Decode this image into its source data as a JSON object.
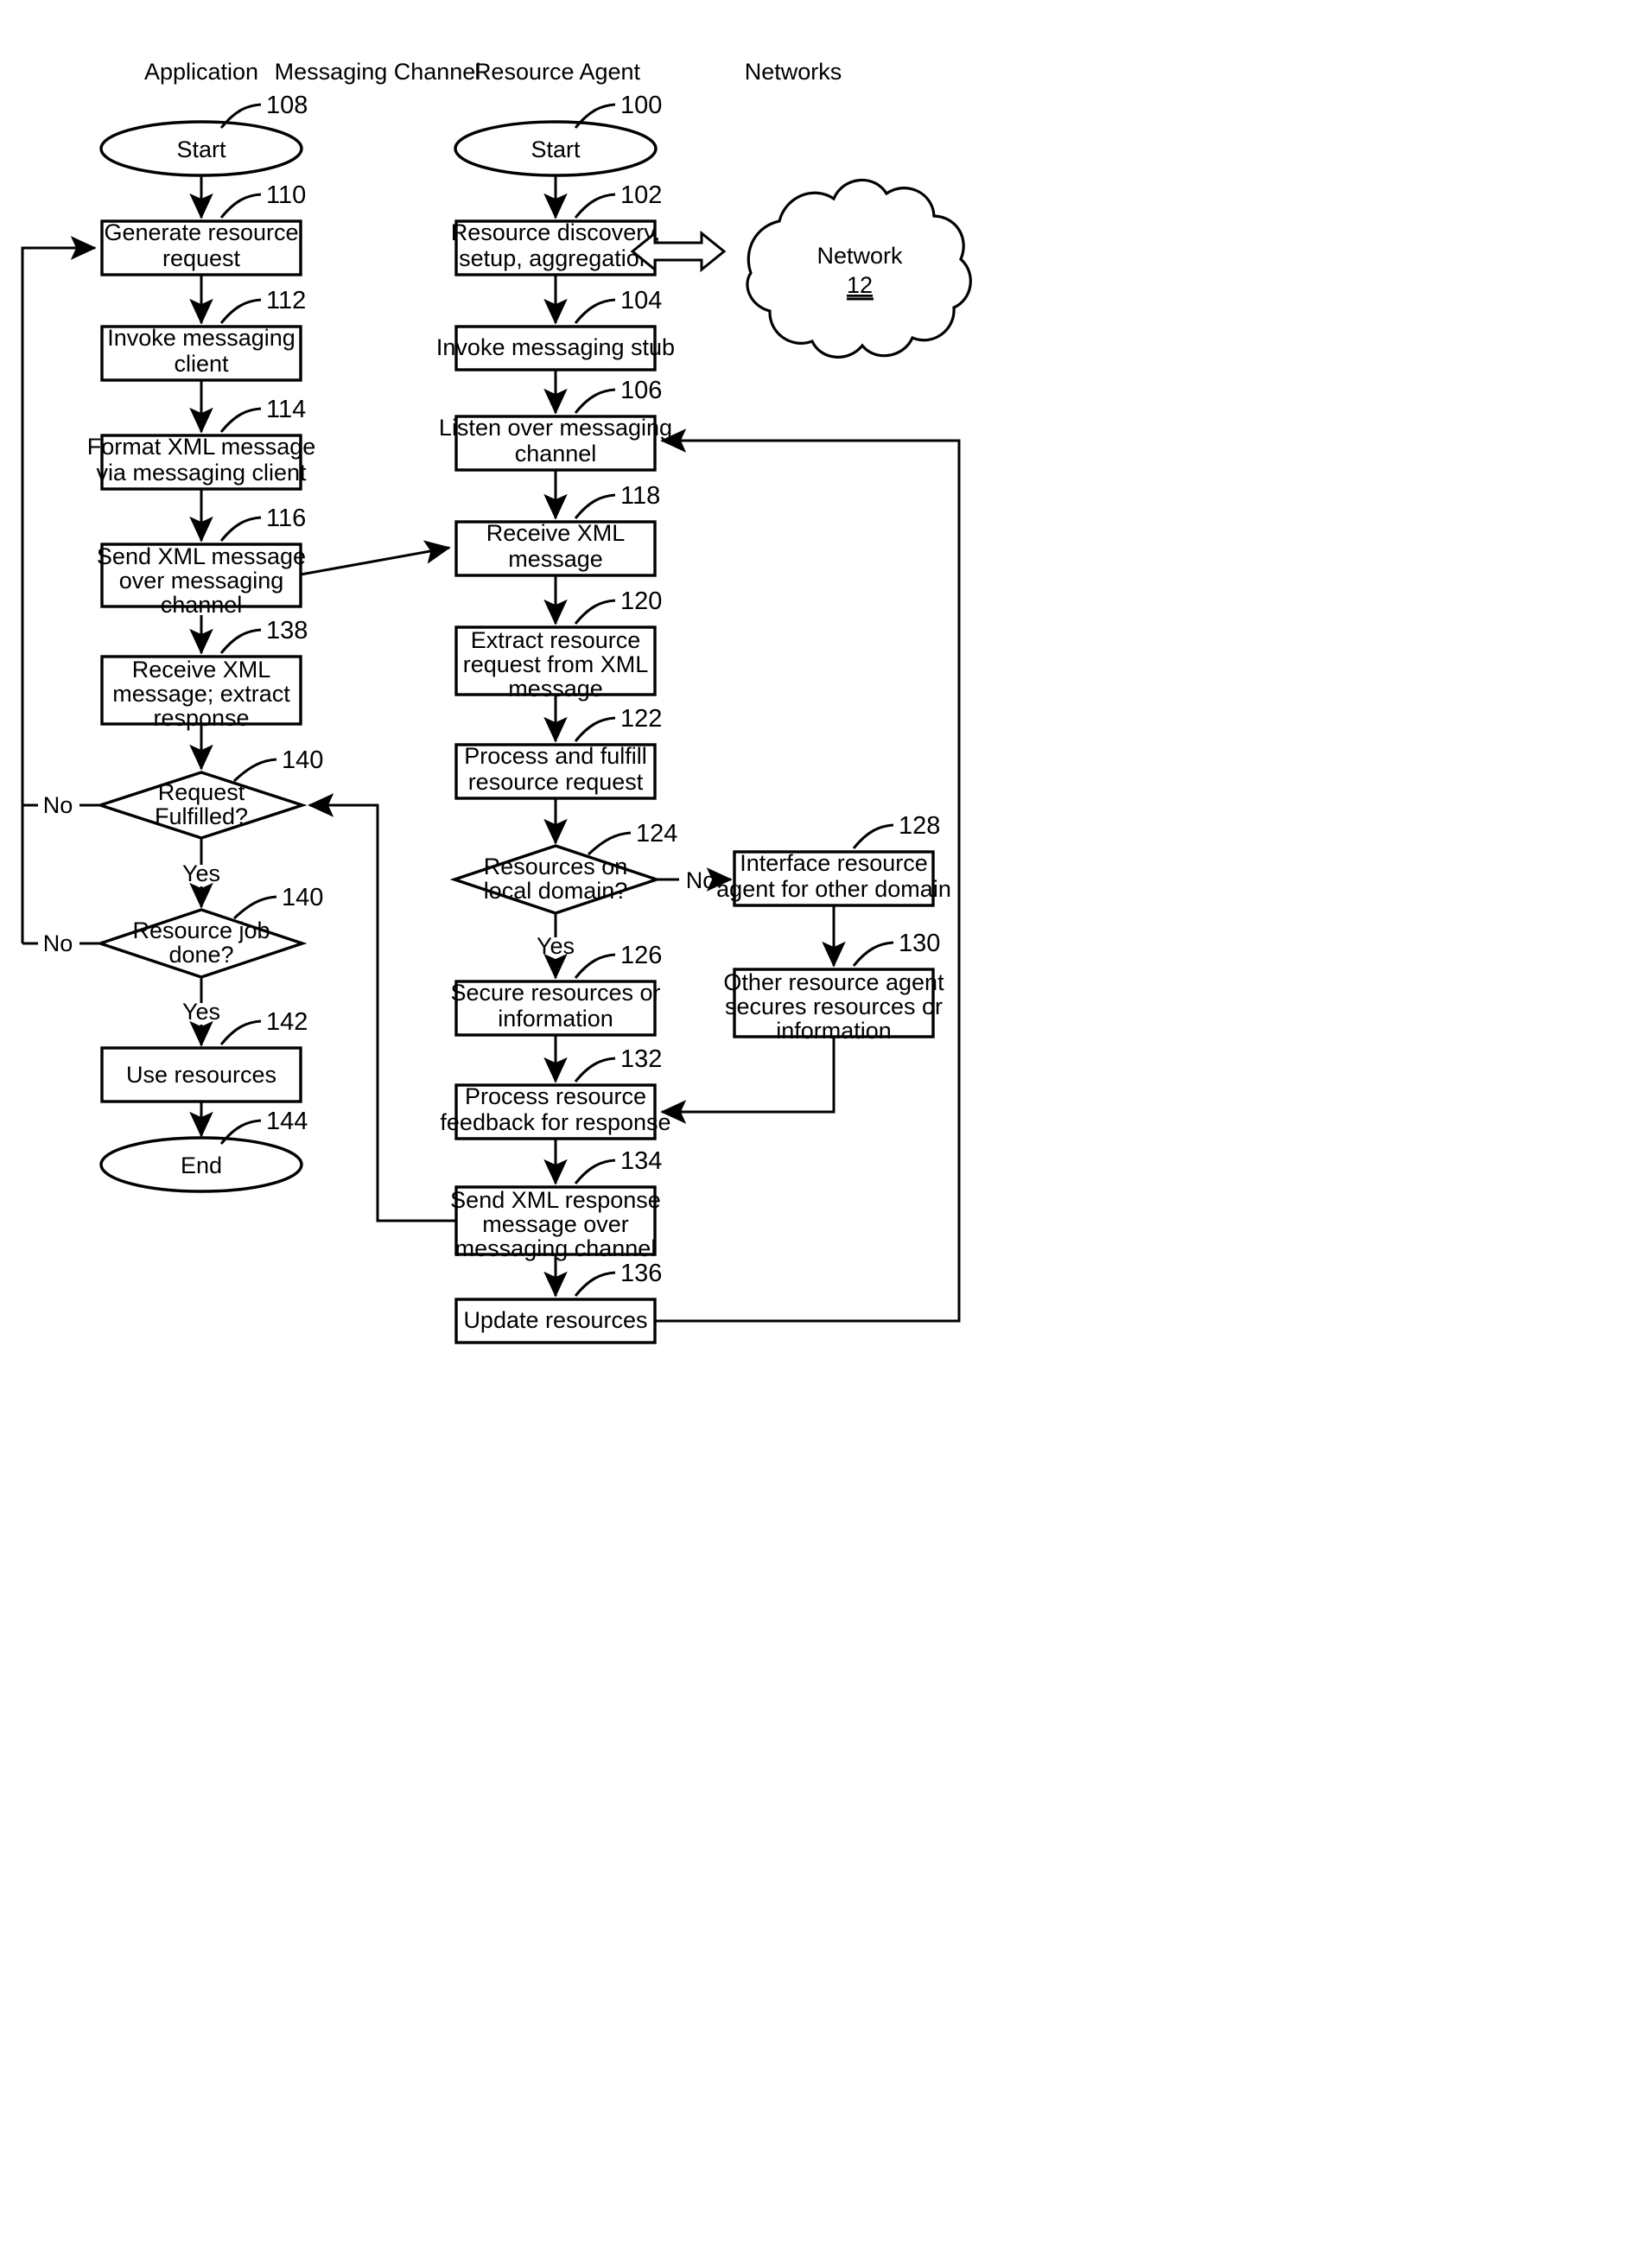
{
  "figure": {
    "type": "patent-flowchart",
    "columns": [
      {
        "id": "application",
        "label": "Application"
      },
      {
        "id": "messaging-channel",
        "label": "Messaging Channel"
      },
      {
        "id": "resource-agent",
        "label": "Resource Agent"
      },
      {
        "id": "networks",
        "label": "Networks"
      }
    ],
    "application_flow": {
      "start": {
        "ref": "108",
        "label": "Start"
      },
      "steps": [
        {
          "ref": "110",
          "label": "Generate resource request"
        },
        {
          "ref": "112",
          "label": "Invoke messaging client"
        },
        {
          "ref": "114",
          "label": "Format XML message via messaging client"
        },
        {
          "ref": "116",
          "label": "Send XML message over messaging channel"
        },
        {
          "ref": "138",
          "label": "Receive XML message; extract response"
        }
      ],
      "decisions": [
        {
          "ref": "140",
          "label": "Request Fulfilled?",
          "no_label": "No",
          "yes_label": "Yes"
        },
        {
          "ref": "140",
          "label": "Resource job done?",
          "no_label": "No",
          "yes_label": "Yes"
        }
      ],
      "final_step": {
        "ref": "142",
        "label": "Use resources"
      },
      "end": {
        "ref": "144",
        "label": "End"
      }
    },
    "agent_flow": {
      "start": {
        "ref": "100",
        "label": "Start"
      },
      "steps": [
        {
          "ref": "102",
          "label": "Resource discovery, setup, aggregation"
        },
        {
          "ref": "104",
          "label": "Invoke messaging stub"
        },
        {
          "ref": "106",
          "label": "Listen over messaging channel"
        },
        {
          "ref": "118",
          "label": "Receive XML message"
        },
        {
          "ref": "120",
          "label": "Extract resource request from XML message"
        },
        {
          "ref": "122",
          "label": "Process and fulfill resource request"
        }
      ],
      "decision": {
        "ref": "124",
        "label": "Resources on local domain?",
        "no_label": "No",
        "yes_label": "Yes"
      },
      "local_branch": [
        {
          "ref": "126",
          "label": "Secure resources or information"
        }
      ],
      "other_branch": [
        {
          "ref": "128",
          "label": "Interface resource agent for other domain"
        },
        {
          "ref": "130",
          "label": "Other resource agent secures resources or information"
        }
      ],
      "tail_steps": [
        {
          "ref": "132",
          "label": "Process resource feedback for response"
        },
        {
          "ref": "134",
          "label": "Send XML response message over messaging channel"
        },
        {
          "ref": "136",
          "label": "Update resources"
        }
      ]
    },
    "network_cloud": {
      "label": "Network",
      "ref": "12"
    }
  },
  "lines": {
    "app_start": [
      "Start"
    ],
    "app_110": [
      "Generate resource",
      "request"
    ],
    "app_112": [
      "Invoke messaging",
      "client"
    ],
    "app_114": [
      "Format XML message",
      "via messaging client"
    ],
    "app_116": [
      "Send XML message",
      "over messaging",
      "channel"
    ],
    "app_138": [
      "Receive XML",
      "message; extract",
      "response"
    ],
    "app_140a": [
      "Request",
      "Fulfilled?"
    ],
    "app_140b": [
      "Resource job",
      "done?"
    ],
    "app_142": [
      "Use resources"
    ],
    "app_end": [
      "End"
    ],
    "ag_start": [
      "Start"
    ],
    "ag_102": [
      "Resource discovery,",
      "setup, aggregation"
    ],
    "ag_104": [
      "Invoke messaging stub"
    ],
    "ag_106": [
      "Listen over messaging",
      "channel"
    ],
    "ag_118": [
      "Receive XML",
      "message"
    ],
    "ag_120": [
      "Extract resource",
      "request from XML",
      "message"
    ],
    "ag_122": [
      "Process and fulfill",
      "resource request"
    ],
    "ag_124": [
      "Resources on",
      "local domain?"
    ],
    "ag_126": [
      "Secure resources or",
      "information"
    ],
    "ag_128": [
      "Interface resource",
      "agent for other domain"
    ],
    "ag_130": [
      "Other resource agent",
      "secures resources or",
      "information"
    ],
    "ag_132": [
      "Process resource",
      "feedback for response"
    ],
    "ag_134": [
      "Send XML response",
      "message over",
      "messaging channel"
    ],
    "ag_136": [
      "Update resources"
    ],
    "cloud": [
      "Network",
      "12"
    ]
  },
  "refs": {
    "r100": "100",
    "r102": "102",
    "r104": "104",
    "r106": "106",
    "r108": "108",
    "r110": "110",
    "r112": "112",
    "r114": "114",
    "r116": "116",
    "r118": "118",
    "r120": "120",
    "r122": "122",
    "r124": "124",
    "r126": "126",
    "r128": "128",
    "r130": "130",
    "r132": "132",
    "r134": "134",
    "r136": "136",
    "r138": "138",
    "r140a": "140",
    "r140b": "140",
    "r142": "142",
    "r144": "144",
    "r12": "12"
  },
  "edge_labels": {
    "no1": "No",
    "yes1": "Yes",
    "no2": "No",
    "yes2": "Yes",
    "no3": "No",
    "yes3": "Yes"
  },
  "colors": {
    "ink": "#000000",
    "paper": "#ffffff"
  }
}
